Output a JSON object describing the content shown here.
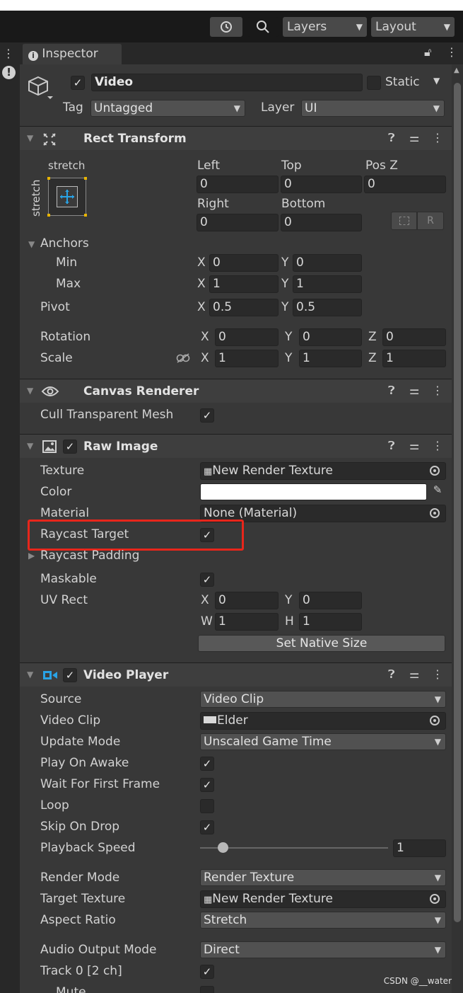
{
  "toolbar": {
    "layers_label": "Layers",
    "layout_label": "Layout"
  },
  "tab": {
    "label": "Inspector"
  },
  "object": {
    "name": "Video",
    "static_label": "Static",
    "tag_label": "Tag",
    "tag_value": "Untagged",
    "layer_label": "Layer",
    "layer_value": "UI"
  },
  "rect_transform": {
    "title": "Rect Transform",
    "stretch_top": "stretch",
    "stretch_side": "stretch",
    "left_label": "Left",
    "top_label": "Top",
    "posz_label": "Pos Z",
    "left": "0",
    "top": "0",
    "posz": "0",
    "right_label": "Right",
    "bottom_label": "Bottom",
    "right": "0",
    "bottom": "0",
    "anchors_label": "Anchors",
    "min_label": "Min",
    "max_label": "Max",
    "min_x": "0",
    "min_y": "0",
    "max_x": "1",
    "max_y": "1",
    "pivot_label": "Pivot",
    "pivot_x": "0.5",
    "pivot_y": "0.5",
    "rotation_label": "Rotation",
    "rot_x": "0",
    "rot_y": "0",
    "rot_z": "0",
    "scale_label": "Scale",
    "scale_x": "1",
    "scale_y": "1",
    "scale_z": "1",
    "x": "X",
    "y": "Y",
    "z": "Z"
  },
  "canvas_renderer": {
    "title": "Canvas Renderer",
    "cull_label": "Cull Transparent Mesh"
  },
  "raw_image": {
    "title": "Raw Image",
    "texture_label": "Texture",
    "texture_value": "New Render Texture",
    "color_label": "Color",
    "color_value": "#ffffff",
    "material_label": "Material",
    "material_value": "None (Material)",
    "raycast_label": "Raycast Target",
    "raycast_padding_label": "Raycast Padding",
    "maskable_label": "Maskable",
    "uvrect_label": "UV Rect",
    "uv_x": "0",
    "uv_y": "0",
    "uv_w": "1",
    "uv_h": "1",
    "w": "W",
    "h": "H",
    "set_native_label": "Set Native Size"
  },
  "video_player": {
    "title": "Video Player",
    "source_label": "Source",
    "source_value": "Video Clip",
    "clip_label": "Video Clip",
    "clip_value": "Elder",
    "update_label": "Update Mode",
    "update_value": "Unscaled Game Time",
    "play_label": "Play On Awake",
    "wait_label": "Wait For First Frame",
    "loop_label": "Loop",
    "skip_label": "Skip On Drop",
    "speed_label": "Playback Speed",
    "speed_value": "1",
    "render_label": "Render Mode",
    "render_value": "Render Texture",
    "target_label": "Target Texture",
    "target_value": "New Render Texture",
    "aspect_label": "Aspect Ratio",
    "aspect_value": "Stretch",
    "audio_label": "Audio Output Mode",
    "audio_value": "Direct",
    "track_label": "Track 0 [2 ch]",
    "mute_label": "Mute",
    "playback_speed_fraction": 0.12
  },
  "check_mark": "✓",
  "watermark": "CSDN @__water",
  "colors": {
    "highlight": "#e8261b",
    "panel": "#383838",
    "header": "#3e3e3e"
  }
}
